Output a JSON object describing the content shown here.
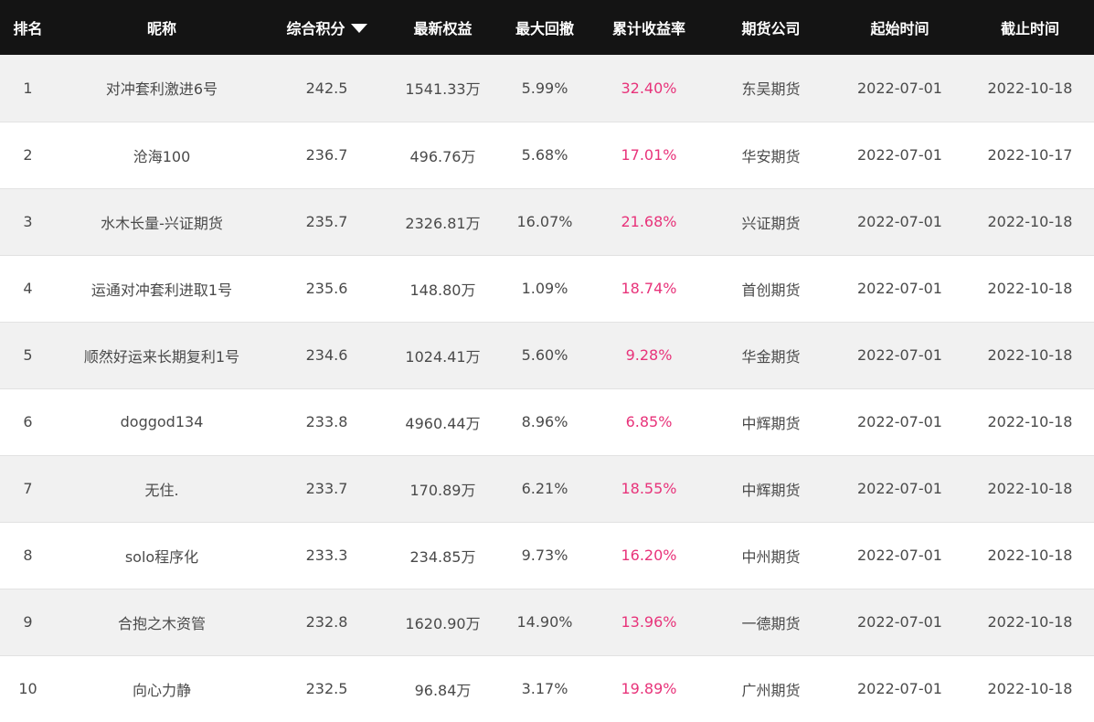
{
  "colors": {
    "header_bg": "#141414",
    "header_text": "#ffffff",
    "row_alt_bg": "#f1f1f1",
    "body_text": "#4a4a4a",
    "return_accent": "#e8337a"
  },
  "header": {
    "rank": "排名",
    "nickname": "昵称",
    "score": "综合积分",
    "sort_icon": "caret-down-icon",
    "equity": "最新权益",
    "drawdown": "最大回撤",
    "cum_return": "累计收益率",
    "company": "期货公司",
    "start": "起始时间",
    "end": "截止时间"
  },
  "rows": [
    {
      "rank": "1",
      "nickname": "对冲套利激进6号",
      "score": "242.5",
      "equity": "1541.33万",
      "drawdown": "5.99%",
      "cum_return": "32.40%",
      "company": "东吴期货",
      "start": "2022-07-01",
      "end": "2022-10-18"
    },
    {
      "rank": "2",
      "nickname": "沧海100",
      "score": "236.7",
      "equity": "496.76万",
      "drawdown": "5.68%",
      "cum_return": "17.01%",
      "company": "华安期货",
      "start": "2022-07-01",
      "end": "2022-10-17"
    },
    {
      "rank": "3",
      "nickname": "水木长量-兴证期货",
      "score": "235.7",
      "equity": "2326.81万",
      "drawdown": "16.07%",
      "cum_return": "21.68%",
      "company": "兴证期货",
      "start": "2022-07-01",
      "end": "2022-10-18"
    },
    {
      "rank": "4",
      "nickname": "运通对冲套利进取1号",
      "score": "235.6",
      "equity": "148.80万",
      "drawdown": "1.09%",
      "cum_return": "18.74%",
      "company": "首创期货",
      "start": "2022-07-01",
      "end": "2022-10-18"
    },
    {
      "rank": "5",
      "nickname": "顺然好运来长期复利1号",
      "score": "234.6",
      "equity": "1024.41万",
      "drawdown": "5.60%",
      "cum_return": "9.28%",
      "company": "华金期货",
      "start": "2022-07-01",
      "end": "2022-10-18"
    },
    {
      "rank": "6",
      "nickname": "doggod134",
      "score": "233.8",
      "equity": "4960.44万",
      "drawdown": "8.96%",
      "cum_return": "6.85%",
      "company": "中辉期货",
      "start": "2022-07-01",
      "end": "2022-10-18"
    },
    {
      "rank": "7",
      "nickname": "无住.",
      "score": "233.7",
      "equity": "170.89万",
      "drawdown": "6.21%",
      "cum_return": "18.55%",
      "company": "中辉期货",
      "start": "2022-07-01",
      "end": "2022-10-18"
    },
    {
      "rank": "8",
      "nickname": "solo程序化",
      "score": "233.3",
      "equity": "234.85万",
      "drawdown": "9.73%",
      "cum_return": "16.20%",
      "company": "中州期货",
      "start": "2022-07-01",
      "end": "2022-10-18"
    },
    {
      "rank": "9",
      "nickname": "合抱之木资管",
      "score": "232.8",
      "equity": "1620.90万",
      "drawdown": "14.90%",
      "cum_return": "13.96%",
      "company": "一德期货",
      "start": "2022-07-01",
      "end": "2022-10-18"
    },
    {
      "rank": "10",
      "nickname": "向心力静",
      "score": "232.5",
      "equity": "96.84万",
      "drawdown": "3.17%",
      "cum_return": "19.89%",
      "company": "广州期货",
      "start": "2022-07-01",
      "end": "2022-10-18"
    }
  ]
}
